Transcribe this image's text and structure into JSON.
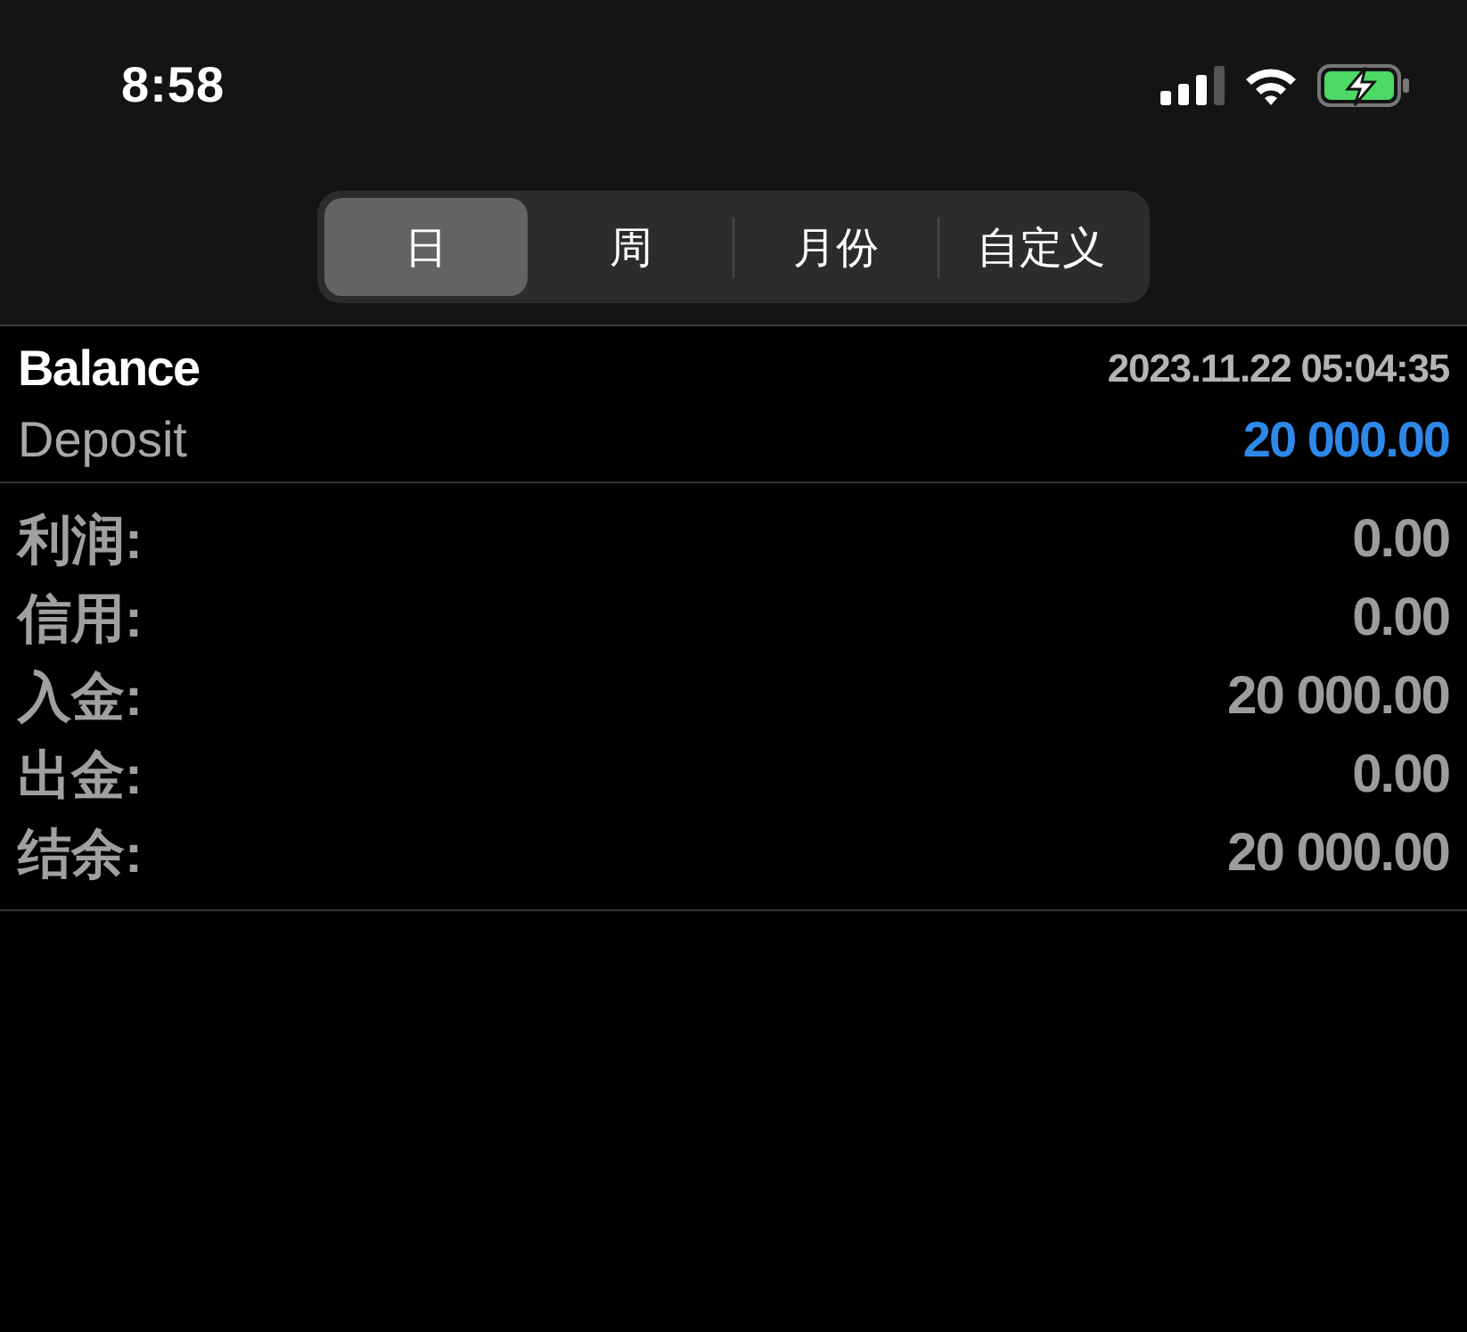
{
  "status_bar": {
    "time": "8:58"
  },
  "period_tabs": [
    {
      "label": "日",
      "selected": true
    },
    {
      "label": "周",
      "selected": false
    },
    {
      "label": "月份",
      "selected": false
    },
    {
      "label": "自定义",
      "selected": false
    }
  ],
  "operation": {
    "type": "Balance",
    "time": "2023.11.22 05:04:35",
    "comment": "Deposit",
    "amount": "20 000.00"
  },
  "summary": [
    {
      "label": "利润:",
      "value": "0.00"
    },
    {
      "label": "信用:",
      "value": "0.00"
    },
    {
      "label": "入金:",
      "value": "20 000.00"
    },
    {
      "label": "出金:",
      "value": "0.00"
    },
    {
      "label": "结余:",
      "value": "20 000.00"
    }
  ]
}
